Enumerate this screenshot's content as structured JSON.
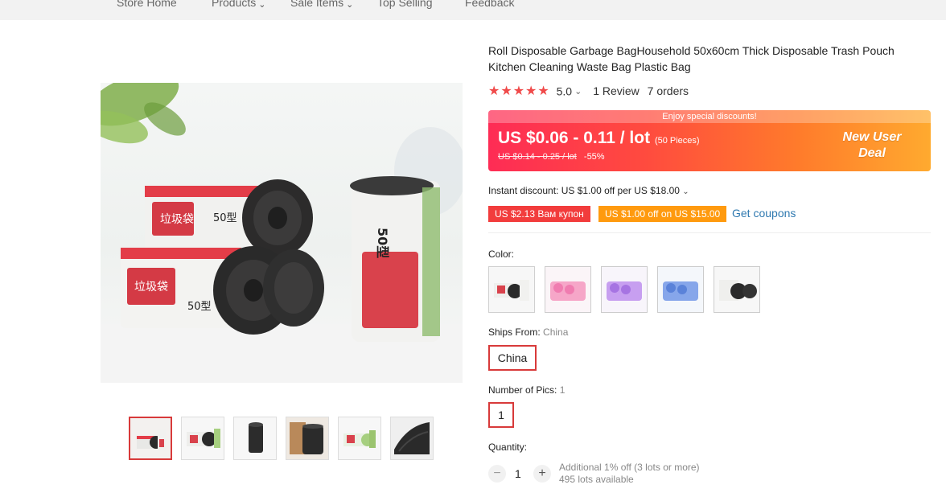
{
  "nav": {
    "store_home": "Store Home",
    "products": "Products",
    "sale_items": "Sale Items",
    "top_selling": "Top Selling",
    "feedback": "Feedback"
  },
  "product": {
    "title": "Roll Disposable Garbage BagHousehold 50x60cm Thick Disposable Trash Pouch Kitchen Cleaning Waste Bag Plastic Bag",
    "rating_value": "5.0",
    "reviews": "1 Review",
    "orders": "7 orders"
  },
  "promo": {
    "banner": "Enjoy special discounts!",
    "price": "US $0.06 - 0.11 / lot",
    "pieces": "(50 Pieces)",
    "old_price": "US $0.14 - 0.25 / lot",
    "discount": "-55%",
    "new_user_line1": "New User",
    "new_user_line2": "Deal"
  },
  "discounts": {
    "instant": "Instant discount: US $1.00 off per US $18.00",
    "coupon1": "US $2.13 Вам купон",
    "coupon2": "US $1.00 off on US $15.00",
    "get_coupons": "Get coupons"
  },
  "options": {
    "color_label": "Color:",
    "ships_from_label": "Ships From:",
    "ships_from_value": "China",
    "ships_from_option": "China",
    "pics_label": "Number of Pics:",
    "pics_value": "1",
    "pics_option": "1"
  },
  "quantity": {
    "label": "Quantity:",
    "minus": "−",
    "value": "1",
    "plus": "+",
    "note1": "Additional 1% off (3 lots or more)",
    "note2": "495 lots available"
  },
  "colors": {
    "accent_red": "#d83a3a",
    "link_blue": "#2f79b0",
    "star_red": "#f04a4a"
  }
}
